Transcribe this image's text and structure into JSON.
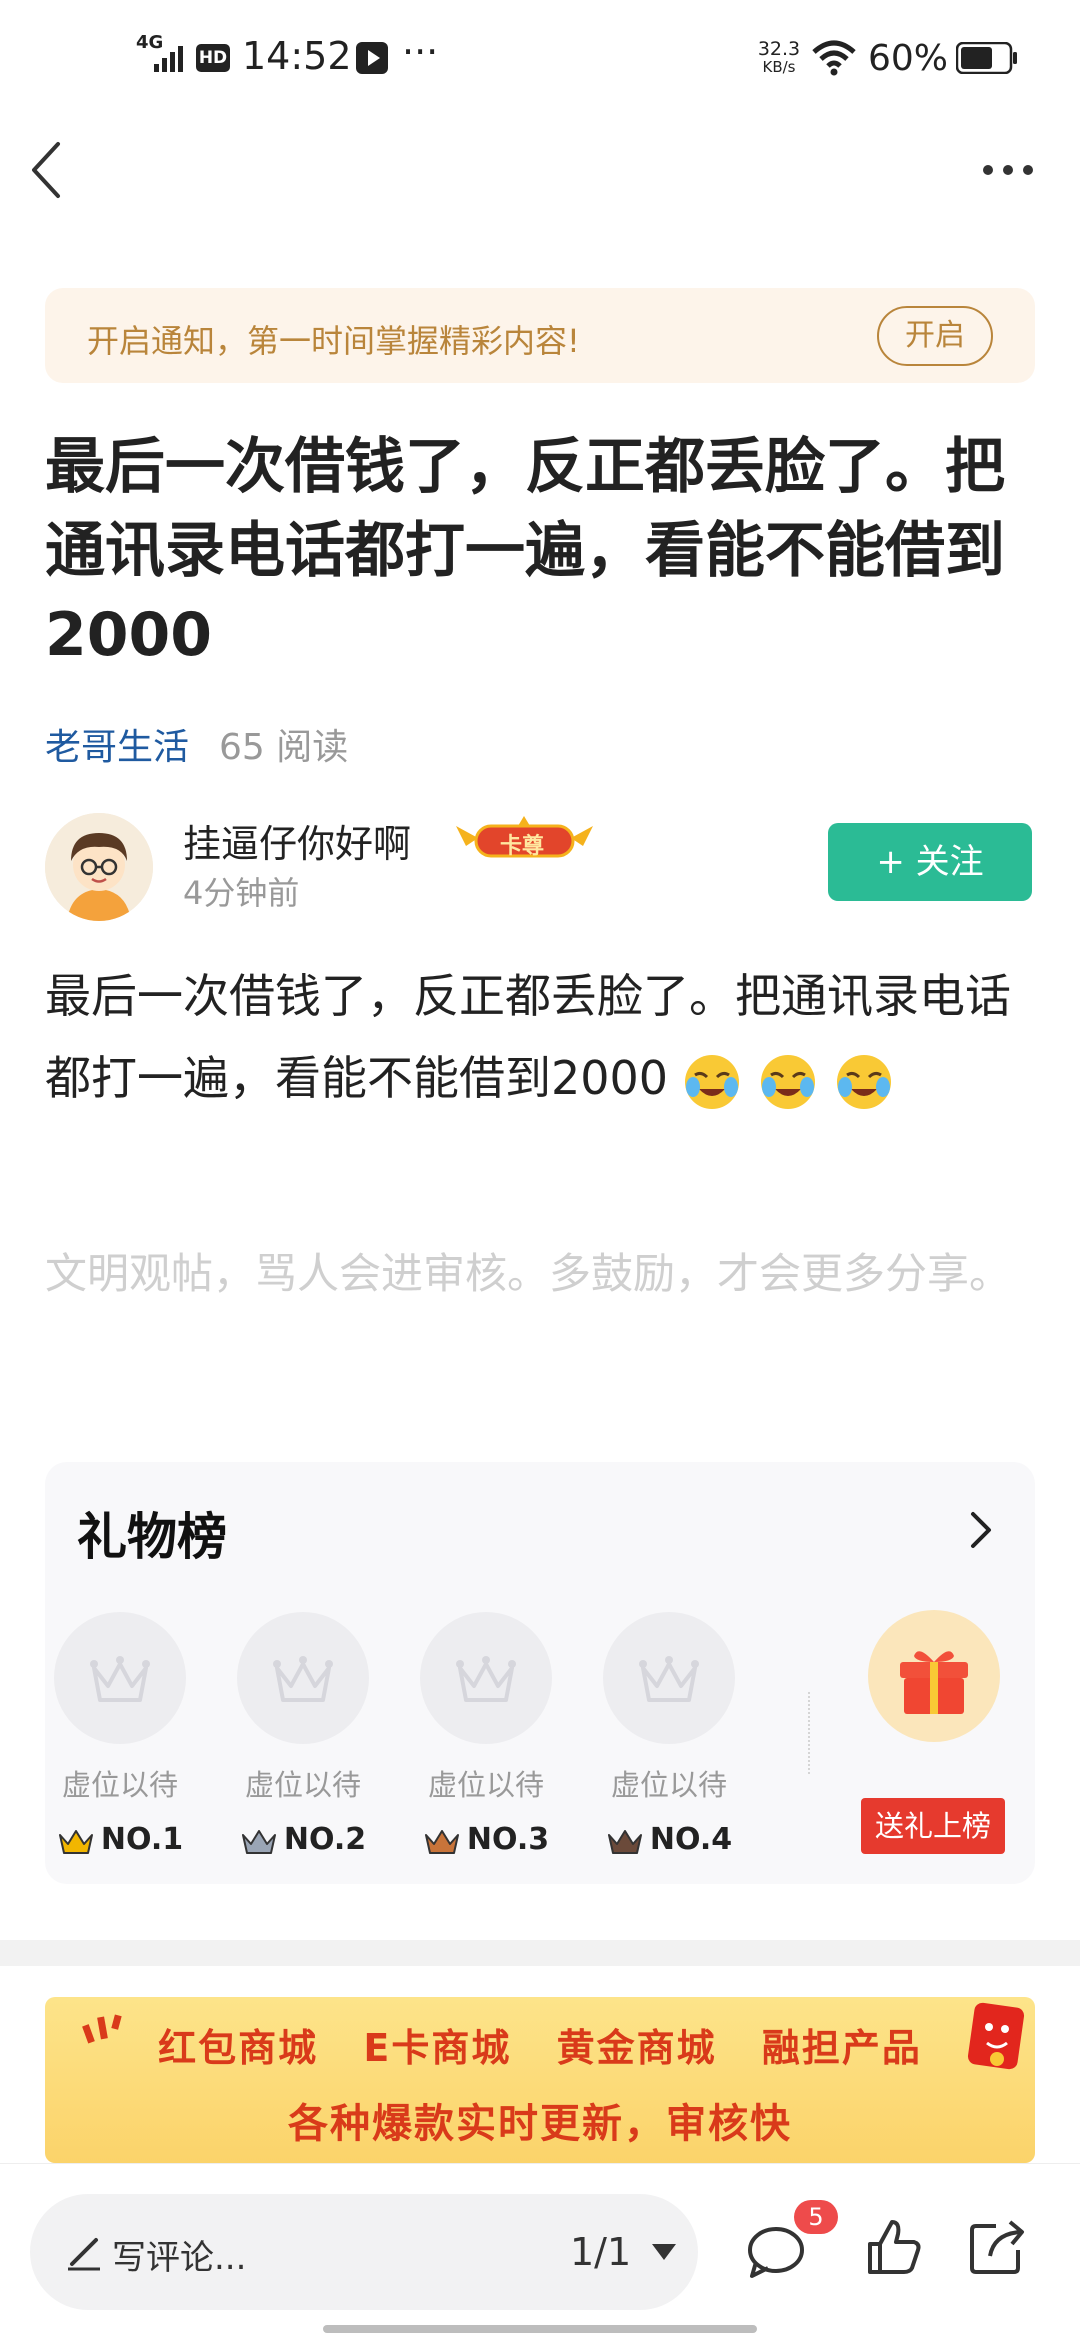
{
  "status_bar": {
    "network": "4G",
    "hd": "HD",
    "time": "14:52",
    "more": "···",
    "speed_value": "32.3",
    "speed_unit": "KB/s",
    "battery": "60%"
  },
  "notice": {
    "text": "开启通知，第一时间掌握精彩内容!",
    "button": "开启"
  },
  "post": {
    "title": "最后一次借钱了，反正都丢脸了。把通讯录电话都打一遍，看能不能借到2000",
    "circle": "老哥生活",
    "reads": "65 阅读",
    "author": "挂逼仔你好啊",
    "badge": "卡尊",
    "time": "4分钟前",
    "follow": "+ 关注",
    "content": "最后一次借钱了，反正都丢脸了。把通讯录电话都打一遍，看能不能借到2000",
    "hint": "文明观帖，骂人会进审核。多鼓励，才会更多分享。"
  },
  "gift_board": {
    "title": "礼物榜",
    "slots": [
      {
        "label": "虚位以待",
        "rank": "NO.1",
        "color": "#f2b600"
      },
      {
        "label": "虚位以待",
        "rank": "NO.2",
        "color": "#9aa5b5"
      },
      {
        "label": "虚位以待",
        "rank": "NO.3",
        "color": "#c8743a"
      },
      {
        "label": "虚位以待",
        "rank": "NO.4",
        "color": "#6b4a3a"
      }
    ],
    "send": "送礼上榜"
  },
  "banner": {
    "line1": "红包商城 E卡商城 黄金商城 融担产品",
    "line2": "各种爆款实时更新，审核快"
  },
  "bottom_bar": {
    "comment_placeholder": "写评论...",
    "page": "1/1",
    "comment_count": "5"
  }
}
